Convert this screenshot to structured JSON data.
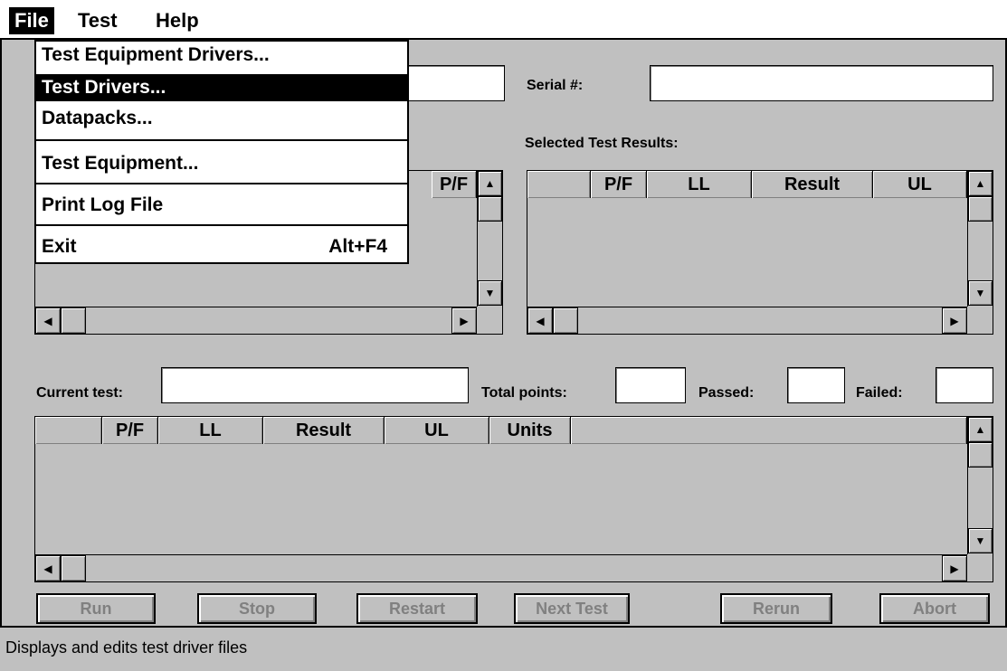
{
  "menubar": {
    "file": "File",
    "test": "Test",
    "help": "Help"
  },
  "file_menu": {
    "items": [
      {
        "label": "Test Equipment Drivers...",
        "shortcut": ""
      },
      {
        "label": "Test Drivers...",
        "shortcut": ""
      },
      {
        "label": "Datapacks...",
        "shortcut": ""
      },
      {
        "label": "Test Equipment...",
        "shortcut": ""
      },
      {
        "label": "Print Log File",
        "shortcut": ""
      },
      {
        "label": "Exit",
        "shortcut": "Alt+F4"
      }
    ],
    "highlighted_index": 1
  },
  "top_right": {
    "serial_label": "Serial #:",
    "serial_value": "",
    "selected_label": "Selected Test Results:"
  },
  "left_grid": {
    "columns": [
      "P/F"
    ]
  },
  "selected_grid": {
    "columns": [
      "",
      "P/F",
      "LL",
      "Result",
      "UL"
    ]
  },
  "current": {
    "current_label": "Current test:",
    "current_value": "",
    "total_label": "Total points:",
    "total_value": "",
    "passed_label": "Passed:",
    "passed_value": "",
    "failed_label": "Failed:",
    "failed_value": ""
  },
  "results_grid": {
    "columns": [
      "",
      "P/F",
      "LL",
      "Result",
      "UL",
      "Units",
      ""
    ]
  },
  "buttons": {
    "run": "Run",
    "stop": "Stop",
    "restart": "Restart",
    "next": "Next Test",
    "rerun": "Rerun",
    "abort": "Abort"
  },
  "status": {
    "text": "Displays and edits test driver files"
  },
  "arrows": {
    "up": "▲",
    "down": "▼",
    "left": "◀",
    "right": "▶"
  }
}
